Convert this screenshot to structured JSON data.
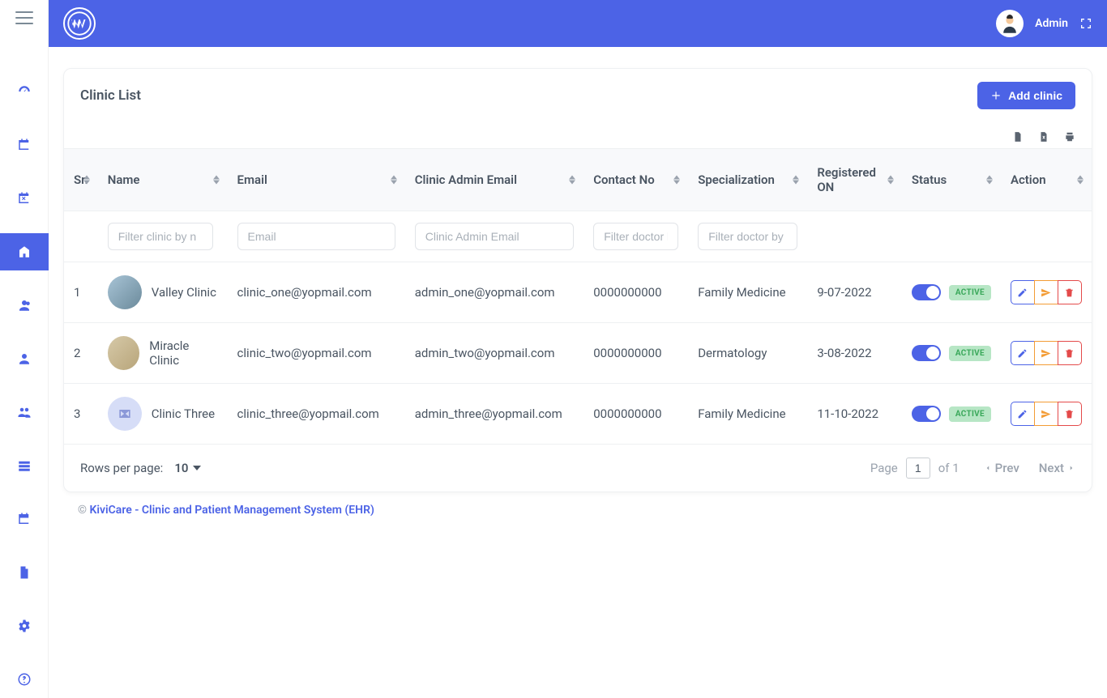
{
  "topbar": {
    "user_label": "Admin"
  },
  "page": {
    "title": "Clinic List",
    "add_button": "Add clinic"
  },
  "table": {
    "columns": {
      "sr": "Sr.",
      "name": "Name",
      "email": "Email",
      "admin_email": "Clinic Admin Email",
      "contact": "Contact No",
      "specialization": "Specialization",
      "registered": "Registered ON",
      "status": "Status",
      "action": "Action"
    },
    "filters": {
      "name_ph": "Filter clinic by n",
      "email_ph": "Email",
      "admin_email_ph": "Clinic Admin Email",
      "contact_ph": "Filter doctor l",
      "specialization_ph": "Filter doctor by"
    },
    "status_labels": {
      "active": "ACTIVE"
    },
    "rows": [
      {
        "sr": "1",
        "name": "Valley Clinic",
        "email": "clinic_one@yopmail.com",
        "admin_email": "admin_one@yopmail.com",
        "contact": "0000000000",
        "specialization": "Family Medicine",
        "registered": "9-07-2022"
      },
      {
        "sr": "2",
        "name": "Miracle Clinic",
        "email": "clinic_two@yopmail.com",
        "admin_email": "admin_two@yopmail.com",
        "contact": "0000000000",
        "specialization": "Dermatology",
        "registered": "3-08-2022"
      },
      {
        "sr": "3",
        "name": "Clinic Three",
        "email": "clinic_three@yopmail.com",
        "admin_email": "admin_three@yopmail.com",
        "contact": "0000000000",
        "specialization": "Family Medicine",
        "registered": "11-10-2022"
      }
    ],
    "footer": {
      "rows_per_page_label": "Rows per page:",
      "rows_per_page_value": "10",
      "page_label": "Page",
      "page_value": "1",
      "of_label": "of 1",
      "prev_label": "Prev",
      "next_label": "Next"
    }
  },
  "footer": {
    "copyright": "©",
    "text": "KiviCare - Clinic and Patient Management System (EHR)"
  }
}
